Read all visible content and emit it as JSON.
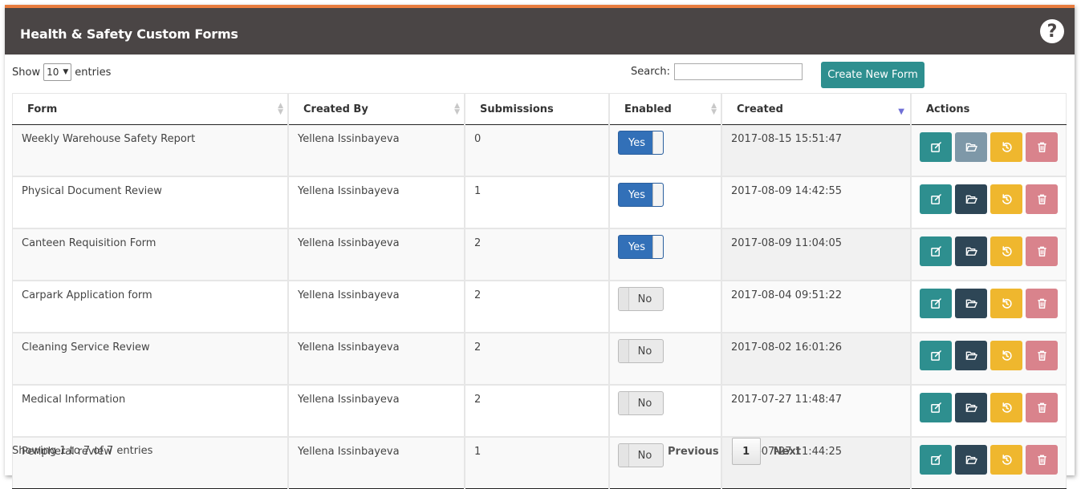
{
  "header": {
    "title": "Health & Safety Custom Forms",
    "help_icon": "question-circle-icon"
  },
  "toolbar": {
    "show_label": "Show",
    "page_length": "10",
    "entries_label": "entries",
    "search_label": "Search:",
    "search_value": "",
    "create_button": "Create New Form"
  },
  "table": {
    "columns": [
      "Form",
      "Created By",
      "Submissions",
      "Enabled",
      "Created",
      "Actions"
    ],
    "sort": {
      "column": "Created",
      "direction": "descending"
    },
    "rows": [
      {
        "form": "Weekly Warehouse Safety Report",
        "created_by": "Yellena Issinbayeva",
        "submissions": "0",
        "enabled": "Yes",
        "created": "2017-08-15 15:51:47"
      },
      {
        "form": "Physical Document Review",
        "created_by": "Yellena Issinbayeva",
        "submissions": "1",
        "enabled": "Yes",
        "created": "2017-08-09 14:42:55"
      },
      {
        "form": "Canteen Requisition Form",
        "created_by": "Yellena Issinbayeva",
        "submissions": "2",
        "enabled": "Yes",
        "created": "2017-08-09 11:04:05"
      },
      {
        "form": "Carpark Application form",
        "created_by": "Yellena Issinbayeva",
        "submissions": "2",
        "enabled": "No",
        "created": "2017-08-04 09:51:22"
      },
      {
        "form": "Cleaning Service Review",
        "created_by": "Yellena Issinbayeva",
        "submissions": "2",
        "enabled": "No",
        "created": "2017-08-02 16:01:26"
      },
      {
        "form": "Medical Information",
        "created_by": "Yellena Issinbayeva",
        "submissions": "2",
        "enabled": "No",
        "created": "2017-07-27 11:48:47"
      },
      {
        "form": "Peripheral review",
        "created_by": "Yellena Issinbayeva",
        "submissions": "1",
        "enabled": "No",
        "created": "2017-07-27 11:44:25"
      }
    ],
    "action_icons": [
      "edit-icon",
      "folder-open-icon",
      "reset-icon",
      "trash-icon"
    ]
  },
  "footer": {
    "info": "Showing 1 to 7 of 7 entries",
    "previous": "Previous",
    "current_page": "1",
    "next": "Next"
  },
  "colors": {
    "accent_orange": "#e87c3e",
    "header_bg": "#4a4545",
    "teal": "#2e8f8f",
    "toggle_on": "#3270b8",
    "open_dark": "#2e4656",
    "reset_yellow": "#efb72e",
    "delete_pink": "#d9838c"
  }
}
